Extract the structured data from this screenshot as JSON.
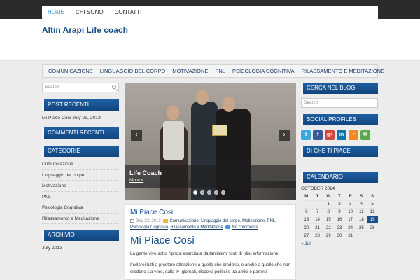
{
  "top_nav": {
    "items": [
      "HOME",
      "CHI SONO",
      "CONTATTI"
    ],
    "active": "HOME"
  },
  "site": {
    "title": "Altin Arapi Life coach"
  },
  "main_nav": {
    "items": [
      "COMUNICAZIONE",
      "LINGUAGGIO DEL CORPO",
      "MOTIVAZIONE",
      "PNL",
      "PSICOLOGIA COGNITIVA",
      "RILASSAMENTO E MEDITAZIONE"
    ]
  },
  "left_sidebar": {
    "search_placeholder": "Search",
    "recent_posts_title": "POST RECENTI",
    "recent_post": "Mi Piace Cosi July 23, 2013",
    "recent_comments_title": "COMMENTI RECENTI",
    "categories_title": "CATEGORIE",
    "categories": [
      "Comunicazione",
      "Linguaggio del corpo",
      "Motivazione",
      "PNL",
      "Psicologia Cognitiva",
      "Rilassamento e Meditazione"
    ],
    "archive_title": "ARCHIVIO",
    "archive_item": "July 2013"
  },
  "slider": {
    "caption_title": "Life Coach",
    "caption_more": "More »",
    "dots": 5,
    "active_dot": 0,
    "prev_icon": "chevron-left",
    "next_icon": "chevron-right"
  },
  "post": {
    "title": "Mi Piace Cosi",
    "date": "July 23, 2013",
    "categories": [
      "Comunicazione",
      "Linguaggio del corpo",
      "Motivazione",
      "PNL",
      "Psicologia Cognitiva",
      "Rilassamento e Meditazione"
    ],
    "comments": "No comments",
    "heading": "Mi Piace Cosi",
    "para1": "La gente vive sotto l'ipnosi esercitata da tantissimi fonti di (dis) informazione.",
    "para2": "Inviterei tutti a prestare attenzione a quello che credono, e anche a quello che non credono sia vero, dalla tv ,giornali, discorsi politici e tra amici e parenti"
  },
  "right_sidebar": {
    "search_title": "CERCA NEL BLOG",
    "search_placeholder": "Search",
    "social_title": "SOCIAL PROFILES",
    "social": [
      {
        "icon": "twitter-icon",
        "label": "t",
        "color": "#3aa9e0"
      },
      {
        "icon": "facebook-icon",
        "label": "f",
        "color": "#3b5998"
      },
      {
        "icon": "google-plus-icon",
        "label": "g+",
        "color": "#d34836"
      },
      {
        "icon": "linkedin-icon",
        "label": "in",
        "color": "#0e76a8"
      },
      {
        "icon": "rss-icon",
        "label": "r",
        "color": "#f08a24"
      },
      {
        "icon": "email-icon",
        "label": "✉",
        "color": "#5aa84a"
      }
    ],
    "likes_title": "DI CHE TI PIACE",
    "calendar_title": "CALENDARIO",
    "calendar": {
      "month": "OCTOBER 2014",
      "days": [
        "M",
        "T",
        "W",
        "T",
        "F",
        "S",
        "S"
      ],
      "weeks": [
        [
          "",
          "",
          "1",
          "2",
          "3",
          "4",
          "5"
        ],
        [
          "6",
          "7",
          "8",
          "9",
          "10",
          "11",
          "12"
        ],
        [
          "13",
          "14",
          "15",
          "16",
          "17",
          "18",
          "19"
        ],
        [
          "20",
          "21",
          "22",
          "23",
          "24",
          "25",
          "26"
        ],
        [
          "27",
          "28",
          "29",
          "30",
          "31",
          "",
          ""
        ]
      ],
      "today": "19",
      "prev": "« Jul"
    }
  }
}
